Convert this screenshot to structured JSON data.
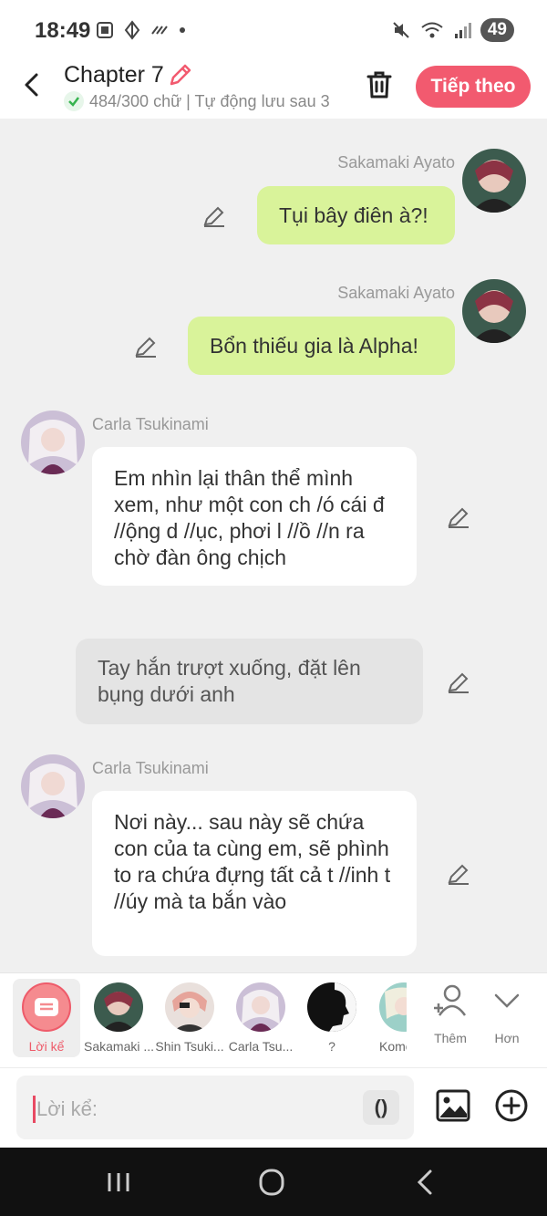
{
  "status": {
    "time": "18:49",
    "battery": "49",
    "net": "5"
  },
  "header": {
    "title": "Chapter 7",
    "subtitle": "484/300 chữ | Tự động lưu sau 3",
    "next_label": "Tiếp theo"
  },
  "messages": [
    {
      "speaker": "Sakamaki Ayato",
      "text": "Tụi bây điên à?!"
    },
    {
      "speaker": "Sakamaki Ayato",
      "text": "Bổn thiếu gia là Alpha!"
    },
    {
      "speaker": "Carla Tsukinami",
      "text": "Em nhìn lại thân thể mình xem, như một con ch /ó cái đ //ộng d //ục, phơi l //ồ //n ra chờ đàn ông chịch"
    },
    {
      "speaker": "",
      "text": "Tay hắn trượt xuống, đặt lên bụng dưới anh"
    },
    {
      "speaker": "Carla Tsukinami",
      "text": "Nơi này... sau này sẽ chứa con của ta cùng em, sẽ phình to ra chứa đựng tất cả t //inh t //úy mà ta bắn vào"
    }
  ],
  "characters": {
    "narrator": "Lời kể",
    "list": [
      "Sakamaki ...",
      "Shin Tsuki...",
      "Carla Tsu...",
      "?",
      "Komo"
    ],
    "add_label": "Thêm",
    "more_label": "Hơn"
  },
  "input": {
    "placeholder": "Lời kể:",
    "paren_label": "()"
  },
  "colors": {
    "accent": "#f25a6f",
    "green_bubble": "#d9f39a",
    "background": "#f0f0f0"
  }
}
